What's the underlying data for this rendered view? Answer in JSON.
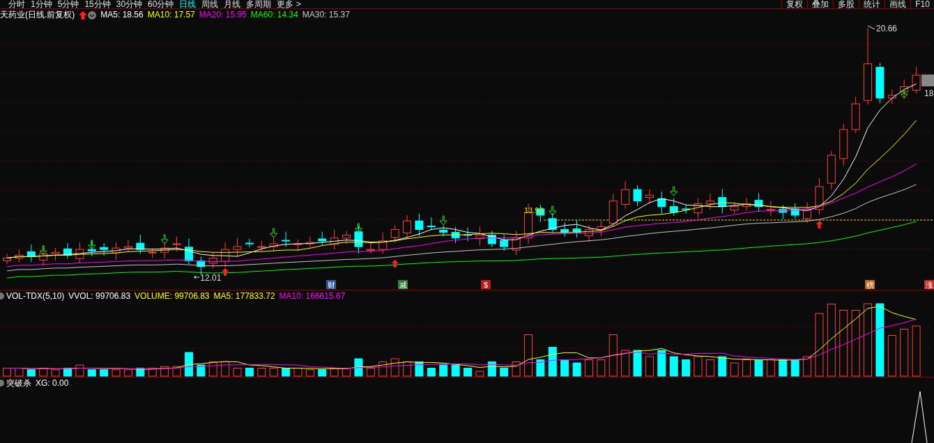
{
  "toolbar": {
    "periods": [
      {
        "label": "分时",
        "selected": false
      },
      {
        "label": "1分钟",
        "selected": false
      },
      {
        "label": "5分钟",
        "selected": false
      },
      {
        "label": "15分钟",
        "selected": false
      },
      {
        "label": "30分钟",
        "selected": false
      },
      {
        "label": "60分钟",
        "selected": false
      },
      {
        "label": "日线",
        "selected": true
      },
      {
        "label": "周线",
        "selected": false
      },
      {
        "label": "月线",
        "selected": false
      },
      {
        "label": "多周期",
        "selected": false
      },
      {
        "label": "更多 >",
        "selected": false
      }
    ],
    "tools": [
      "复权",
      "叠加",
      "多股",
      "统计",
      "画线",
      "F10"
    ]
  },
  "price_panel": {
    "title": "天药业(日线.前复权)",
    "indicators": [
      {
        "label": "MA5: 18.56",
        "color": "#ffffff"
      },
      {
        "label": "MA10: 17.57",
        "color": "#ffff00"
      },
      {
        "label": "MA20: 15.95",
        "color": "#ff00ff"
      },
      {
        "label": "MA60: 14.34",
        "color": "#00ff00"
      },
      {
        "label": "MA30: 15.37",
        "color": "#c8c8c8"
      }
    ],
    "price_labels": [
      {
        "kind": "low",
        "text": "12.01"
      },
      {
        "kind": "high",
        "text": "20.66"
      },
      {
        "kind": "mark",
        "text": "13.93"
      },
      {
        "kind": "edge",
        "text": "18"
      }
    ],
    "event_tags": [
      {
        "text": "财",
        "color": "#2c5aa0"
      },
      {
        "text": "减",
        "color": "#2e7d32"
      },
      {
        "text": "$",
        "color": "#b71c1c"
      },
      {
        "text": "榜",
        "color": "#c0641a"
      },
      {
        "text": "涨",
        "color": "#c62828"
      }
    ]
  },
  "volume_panel": {
    "indicators": [
      {
        "label": "VOL-TDX(5,10)",
        "color": "#ffffff"
      },
      {
        "label": "VVOL: 99706.83",
        "color": "#ffffff"
      },
      {
        "label": "VOLUME: 99706.83",
        "color": "#ffff00"
      },
      {
        "label": "MA5: 177833.72",
        "color": "#ffff00"
      },
      {
        "label": "MA10: 166615.67",
        "color": "#ff00ff"
      }
    ]
  },
  "signal_panel": {
    "indicators": [
      {
        "label": "突破杀"
      },
      {
        "label": "XG: 0.00"
      }
    ]
  }
}
